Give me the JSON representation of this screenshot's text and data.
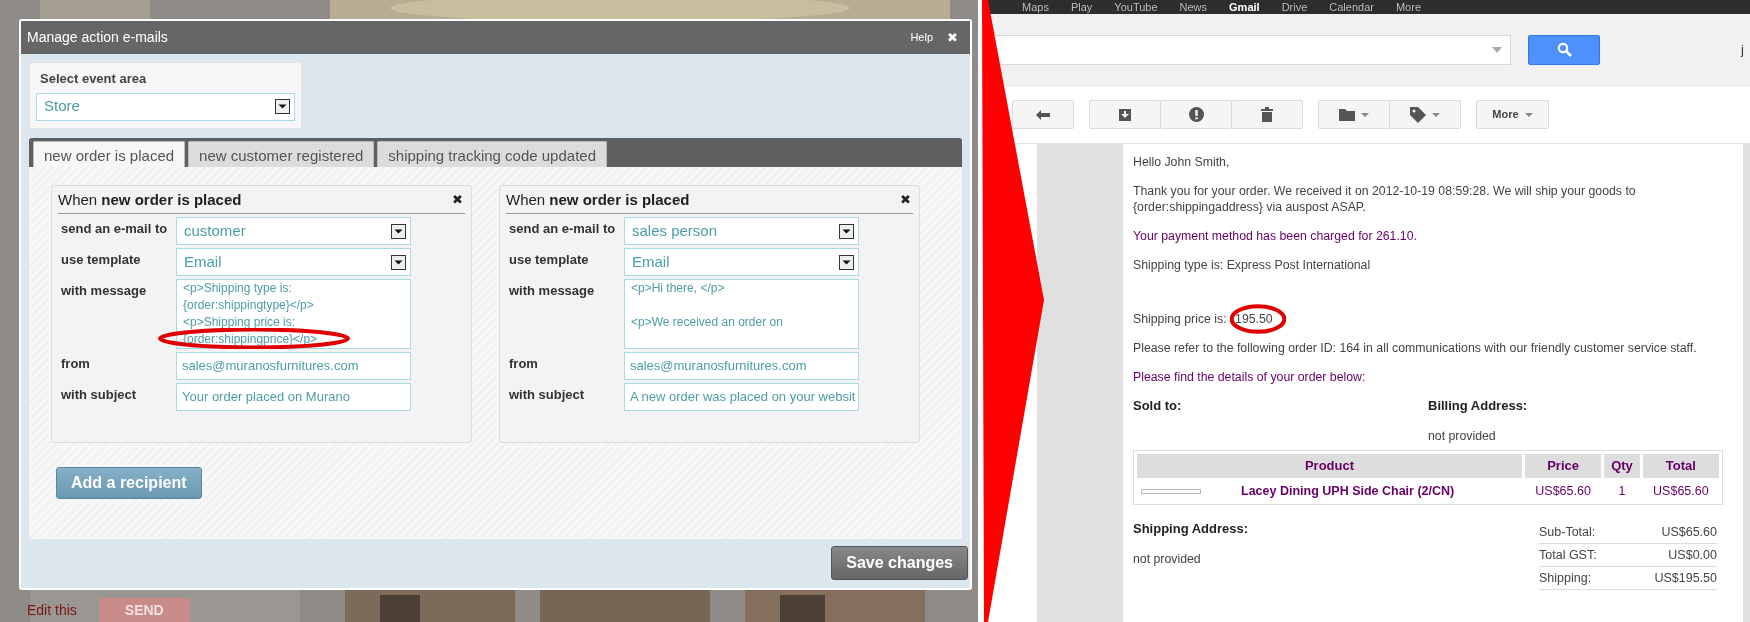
{
  "background_page": {
    "kind": "picture",
    "link": "Edit this",
    "button": "SEND"
  },
  "dialog": {
    "title": "Manage action e-mails",
    "help": "Help",
    "close": "✖",
    "event_area": {
      "label": "Select event area",
      "value": "Store"
    },
    "tabs": [
      {
        "label": "new order is placed",
        "selected": true
      },
      {
        "label": "new customer registered",
        "selected": false
      },
      {
        "label": "shipping tracking code updated",
        "selected": false
      }
    ],
    "recipients": [
      {
        "heading": "When **new order is placed**",
        "close": "✖",
        "fields": [
          {
            "label": "send an e-mail to",
            "kind": "select",
            "value": "customer",
            "highlighted": false
          },
          {
            "label": "use template",
            "kind": "select",
            "value": "Email",
            "highlighted": false
          },
          {
            "label": "with message",
            "kind": "textarea",
            "value": "<p>Shipping type is:\n{order:shippingtype}</p>\n<p>Shipping price is:\n{order:shippingprice}</p>",
            "highlighted": true
          },
          {
            "label": "from",
            "kind": "text",
            "value": "sales@muranosfurnitures.com",
            "highlighted": false
          },
          {
            "label": "with subject",
            "kind": "text",
            "value": "Your order placed on Murano",
            "highlighted": false
          }
        ]
      },
      {
        "heading": "When **new order is placed**",
        "close": "✖",
        "fields": [
          {
            "label": "send an e-mail to",
            "kind": "select",
            "value": "sales person",
            "highlighted": false
          },
          {
            "label": "use template",
            "kind": "select",
            "value": "Email",
            "highlighted": false
          },
          {
            "label": "with message",
            "kind": "textarea",
            "value": "<p>Hi there, </p>\n\n<p>We received an order on",
            "highlighted": false
          },
          {
            "label": "from",
            "kind": "text",
            "value": "sales@muranosfurnitures.com",
            "highlighted": false
          },
          {
            "label": "with subject",
            "kind": "text",
            "value": "A new order was placed on your websit",
            "highlighted": false
          }
        ]
      }
    ],
    "add_button": "Add a recipient",
    "save_button": "Save changes"
  },
  "gmail": {
    "nav": [
      {
        "label": "Maps",
        "selected": false
      },
      {
        "label": "Play",
        "selected": false
      },
      {
        "label": "YouTube",
        "selected": false
      },
      {
        "label": "News",
        "selected": false
      },
      {
        "label": "Gmail",
        "selected": true
      },
      {
        "label": "Drive",
        "selected": false
      },
      {
        "label": "Calendar",
        "selected": false
      },
      {
        "label": "More",
        "selected": false
      }
    ],
    "account_initial": "j",
    "more_button": "More",
    "email": {
      "paragraphs": [
        {
          "kind": "normal",
          "text": "Hello John Smith,"
        },
        {
          "kind": "normal",
          "text": "Thank you for your order. We received it on 2012-10-19 08:59:28. We will ship your goods to {order:shippingaddress} via auspost ASAP."
        },
        {
          "kind": "accent",
          "text": "Your payment method has been charged for 261.10."
        },
        {
          "kind": "normal",
          "text": "Shipping type is: Express Post International"
        },
        {
          "kind": "price",
          "text": "Shipping price is:",
          "value": "195.50",
          "highlighted": true
        },
        {
          "kind": "normal",
          "text": "Please refer to the following order ID: 164 in all communications with our friendly customer service staff."
        },
        {
          "kind": "accent",
          "text": "Please find the details of your order below:"
        }
      ],
      "sold_to": {
        "heading": "Sold to:"
      },
      "billing": {
        "heading": "Billing Address:",
        "value": "not provided"
      },
      "table": {
        "columns": [
          "Product",
          "Price",
          "Qty",
          "Total"
        ],
        "rows": [
          {
            "product": "Lacey Dining UPH Side Chair (2/CN)",
            "price": "US$65.60",
            "qty": "1",
            "total": "US$65.60"
          }
        ]
      },
      "shipping_address": {
        "heading": "Shipping Address:",
        "value": "not provided"
      },
      "totals": [
        {
          "label": "Sub-Total:",
          "value": "US$65.60"
        },
        {
          "label": "Total GST:",
          "value": "US$0.00"
        },
        {
          "label": "Shipping:",
          "value": "US$195.50"
        }
      ]
    }
  }
}
